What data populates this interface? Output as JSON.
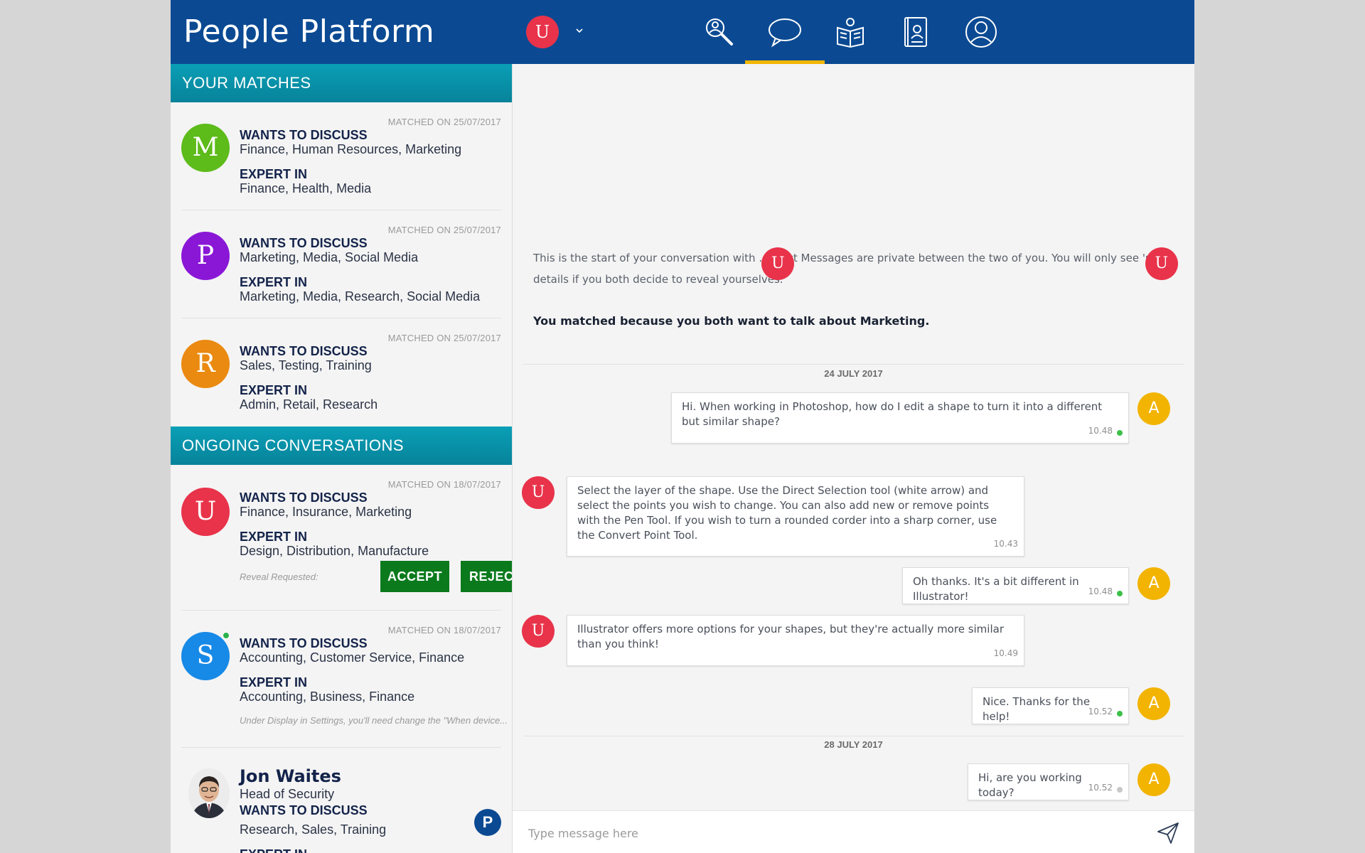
{
  "header": {
    "logo": "People Platform",
    "current_user_initial": "U",
    "nav": [
      {
        "name": "search",
        "icon": "search-people-icon"
      },
      {
        "name": "messages",
        "icon": "chat-bubble-icon",
        "active": true
      },
      {
        "name": "resources",
        "icon": "book-icon"
      },
      {
        "name": "directory",
        "icon": "contact-book-icon"
      },
      {
        "name": "profile",
        "icon": "user-circle-icon"
      }
    ],
    "accent_color": "#f2b600",
    "bg_color": "#0b4a93"
  },
  "sidebar": {
    "matches_title": "YOUR MATCHES",
    "ongoing_title": "ONGOING CONVERSATIONS",
    "matches": [
      {
        "initial": "M",
        "color": "#5dbb1a",
        "date": "MATCHED ON 25/07/2017",
        "discuss_label": "WANTS TO DISCUSS",
        "discuss": "Finance, Human Resources, Marketing",
        "expert_label": "EXPERT IN",
        "expert": "Finance, Health, Media"
      },
      {
        "initial": "P",
        "color": "#8a17d6",
        "date": "MATCHED ON 25/07/2017",
        "discuss_label": "WANTS TO DISCUSS",
        "discuss": "Marketing, Media, Social Media",
        "expert_label": "EXPERT IN",
        "expert": "Marketing, Media, Research, Social Media"
      },
      {
        "initial": "R",
        "color": "#ea8a10",
        "date": "MATCHED ON 25/07/2017",
        "discuss_label": "WANTS TO DISCUSS",
        "discuss": "Sales, Testing, Training",
        "expert_label": "EXPERT IN",
        "expert": "Admin, Retail, Research"
      }
    ],
    "ongoing": [
      {
        "initial": "U",
        "color": "#e8334a",
        "date": "MATCHED ON 18/07/2017",
        "discuss_label": "WANTS TO DISCUSS",
        "discuss": "Finance, Insurance, Marketing",
        "expert_label": "EXPERT IN",
        "expert": "Design, Distribution, Manufacture",
        "reveal": "Reveal Requested:",
        "accept": "ACCEPT",
        "reject": "REJECT"
      },
      {
        "initial": "S",
        "color": "#1789e6",
        "date": "MATCHED ON 18/07/2017",
        "discuss_label": "WANTS TO DISCUSS",
        "discuss": "Accounting, Customer Service, Finance",
        "expert_label": "EXPERT IN",
        "expert": "Accounting, Business, Finance",
        "snippet": "Under Display in Settings, you'll need change the \"When device..."
      },
      {
        "name": "Jon Waites",
        "role": "Head of Security",
        "discuss_label": "WANTS TO DISCUSS",
        "discuss": "Research, Sales, Training",
        "expert_label": "EXPERT IN",
        "badge": "P"
      }
    ]
  },
  "chat": {
    "intro_part1": "This is the start of your conversation with",
    "intro_part2": ". Direct Messages are private between the two of you. You will only see",
    "intro_part3": "'s details if you both decide to reveal yourselves.",
    "matched_reason": "You matched because you both want to talk about Marketing.",
    "days": [
      "24 JULY 2017",
      "28 JULY 2017"
    ],
    "messages": [
      {
        "from": "me",
        "text": "Hi. When working in Photoshop, how do I edit a shape to turn it into a different but similar shape?",
        "time": "10.48",
        "read": true
      },
      {
        "from": "them",
        "text": "Select the layer of the shape. Use the Direct Selection tool (white arrow) and select the points you wish to change. You can also add new or remove points with the Pen Tool. If you wish to turn a rounded corder into a sharp corner, use the Convert Point Tool.",
        "time": "10.43"
      },
      {
        "from": "me",
        "text": "Oh thanks. It's a bit different in Illustrator!",
        "time": "10.48",
        "read": true
      },
      {
        "from": "them",
        "text": "Illustrator offers more options for your shapes, but they're actually more similar than you think!",
        "time": "10.49"
      },
      {
        "from": "me",
        "text": "Nice. Thanks for the help!",
        "time": "10.52",
        "read": true
      },
      {
        "from": "me",
        "text": "Hi, are you working today?",
        "time": "10.52",
        "read": false
      }
    ],
    "my_initial": "A",
    "their_initial": "U",
    "composer_placeholder": "Type message here",
    "read_color": "#3cc04a",
    "unread_color": "#c8c8c8"
  }
}
